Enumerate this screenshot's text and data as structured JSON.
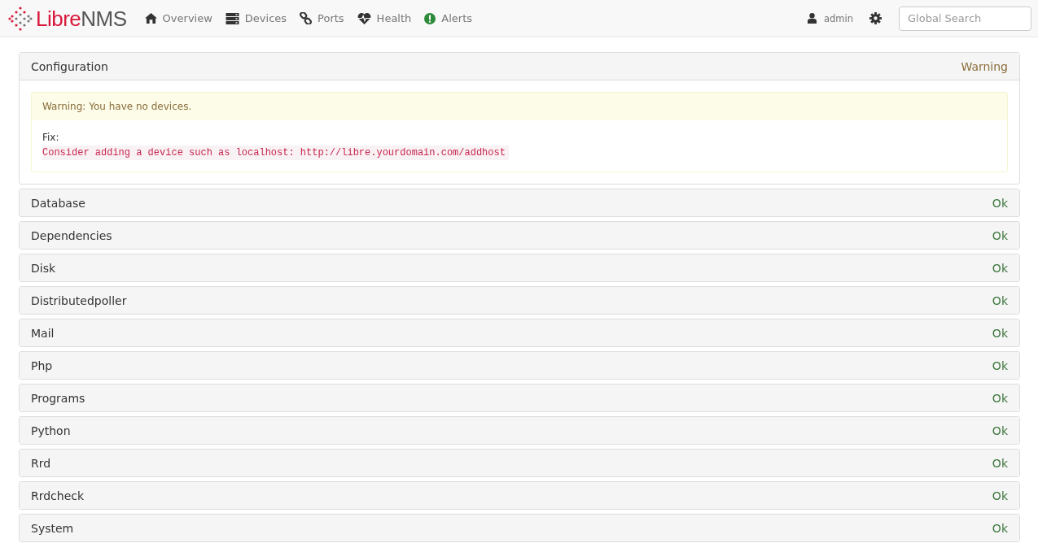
{
  "navbar": {
    "brand_parts": [
      "Libre",
      "NMS"
    ],
    "menu": [
      {
        "label": "Overview",
        "kind": "home"
      },
      {
        "label": "Devices",
        "kind": "server"
      },
      {
        "label": "Ports",
        "kind": "link"
      },
      {
        "label": "Health",
        "kind": "heart"
      },
      {
        "label": "Alerts",
        "kind": "alert"
      }
    ],
    "user": "admin",
    "search": {
      "placeholder": "Global Search"
    }
  },
  "checks": [
    {
      "title": "Configuration",
      "kind": "warning",
      "status_label": "Warning",
      "expanded": true,
      "message": "Warning: You have no devices.",
      "fix_label": "Fix:",
      "fix": "Consider adding a device such as localhost: http://libre.yourdomain.com/addhost"
    },
    {
      "title": "Database",
      "kind": "ok",
      "status_label": "Ok",
      "expanded": false
    },
    {
      "title": "Dependencies",
      "kind": "ok",
      "status_label": "Ok",
      "expanded": false
    },
    {
      "title": "Disk",
      "kind": "ok",
      "status_label": "Ok",
      "expanded": false
    },
    {
      "title": "Distributedpoller",
      "kind": "ok",
      "status_label": "Ok",
      "expanded": false
    },
    {
      "title": "Mail",
      "kind": "ok",
      "status_label": "Ok",
      "expanded": false
    },
    {
      "title": "Php",
      "kind": "ok",
      "status_label": "Ok",
      "expanded": false
    },
    {
      "title": "Programs",
      "kind": "ok",
      "status_label": "Ok",
      "expanded": false
    },
    {
      "title": "Python",
      "kind": "ok",
      "status_label": "Ok",
      "expanded": false
    },
    {
      "title": "Rrd",
      "kind": "ok",
      "status_label": "Ok",
      "expanded": false
    },
    {
      "title": "Rrdcheck",
      "kind": "ok",
      "status_label": "Ok",
      "expanded": false
    },
    {
      "title": "System",
      "kind": "ok",
      "status_label": "Ok",
      "expanded": false
    }
  ]
}
